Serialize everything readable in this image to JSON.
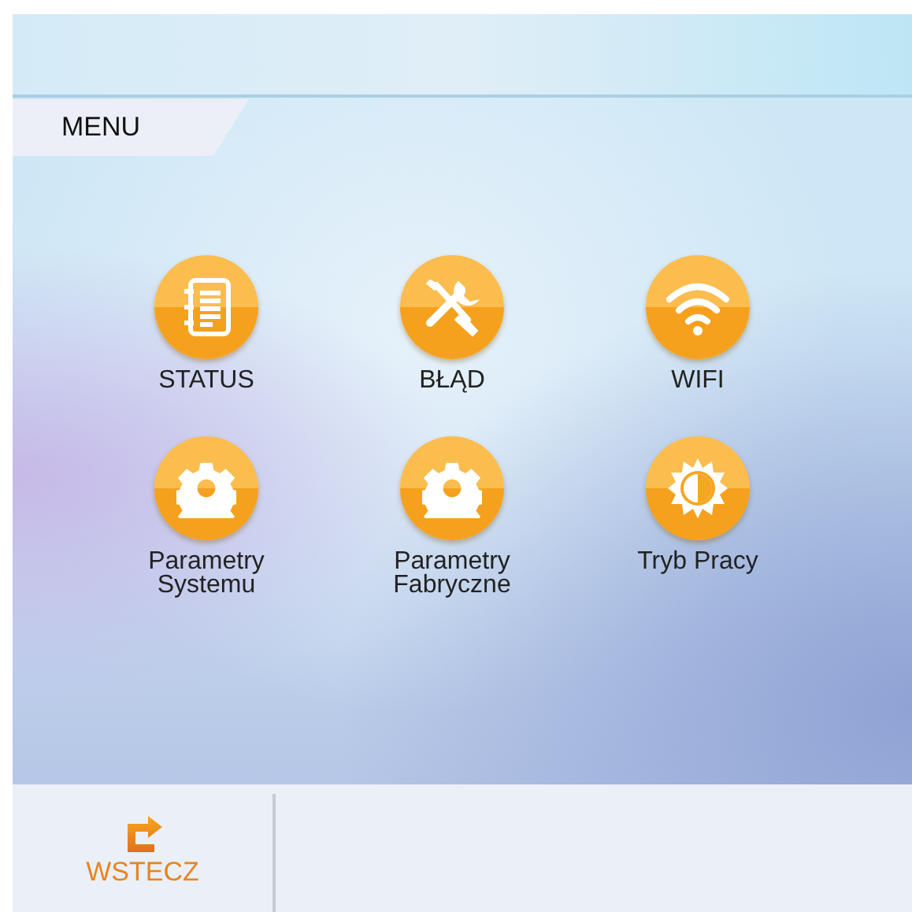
{
  "header": {
    "title": "MENU"
  },
  "menu_items": [
    {
      "label": "STATUS",
      "kind": "notebook"
    },
    {
      "label": "BŁĄD",
      "kind": "tools"
    },
    {
      "label": "WIFI",
      "kind": "wifi"
    },
    {
      "label": "Parametry\nSystemu",
      "kind": "gear"
    },
    {
      "label": "Parametry\nFabryczne",
      "kind": "gear"
    },
    {
      "label": "Tryb Pracy",
      "kind": "brightness"
    }
  ],
  "footer": {
    "back_button": "WSTECZ"
  }
}
